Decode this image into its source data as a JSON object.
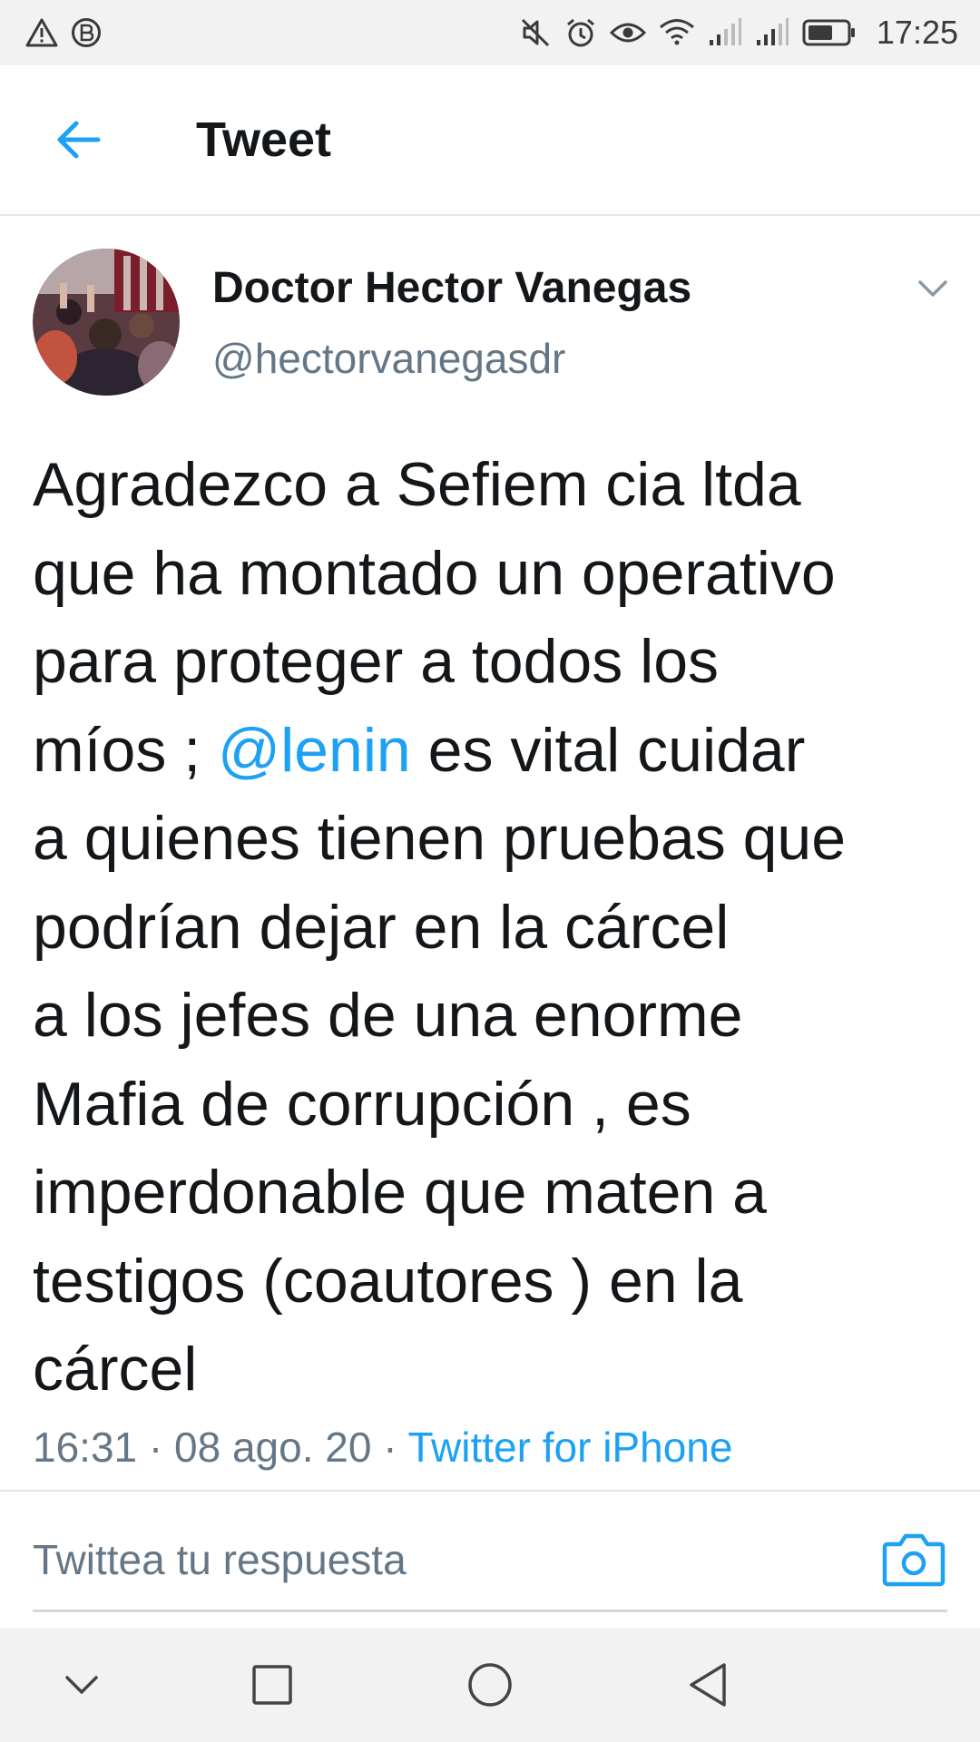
{
  "status_bar": {
    "time": "17:25",
    "left_icons": [
      "warning-icon",
      "b-badge-icon"
    ],
    "right_icons": [
      "mute-icon",
      "alarm-icon",
      "eye-icon",
      "wifi-icon",
      "signal-1-icon",
      "signal-2-icon",
      "battery-icon"
    ]
  },
  "header": {
    "title": "Tweet",
    "back_icon": "arrow-left-icon"
  },
  "tweet": {
    "author_name": "Doctor Hector Vanegas",
    "author_handle": "@hectorvanegasdr",
    "text_lines": [
      "Agradezco a Sefiem cia ltda",
      "que ha montado un operativo",
      "para proteger a todos los",
      {
        "before": "míos ; ",
        "mention": "@lenin",
        "after": " es vital cuidar"
      },
      "a quienes tienen pruebas que",
      "podrían dejar en la cárcel",
      "a los jefes de una enorme",
      "Mafia de corrupción , es",
      "imperdonable que maten a",
      "testigos (coautores ) en la",
      "cárcel"
    ],
    "time": "16:31",
    "date": "08 ago. 20",
    "separator": " · ",
    "source": "Twitter for iPhone"
  },
  "reply": {
    "placeholder": "Twittea tu respuesta",
    "camera_icon": "camera-icon"
  },
  "nav_bar": {
    "buttons": [
      "hide-keyboard-icon",
      "recents-icon",
      "home-icon",
      "back-icon"
    ]
  },
  "colors": {
    "accent": "#1da1f2",
    "text": "#14171a",
    "secondary": "#657786",
    "divider": "#e1e8ed",
    "system_bar": "#f2f2f2"
  }
}
